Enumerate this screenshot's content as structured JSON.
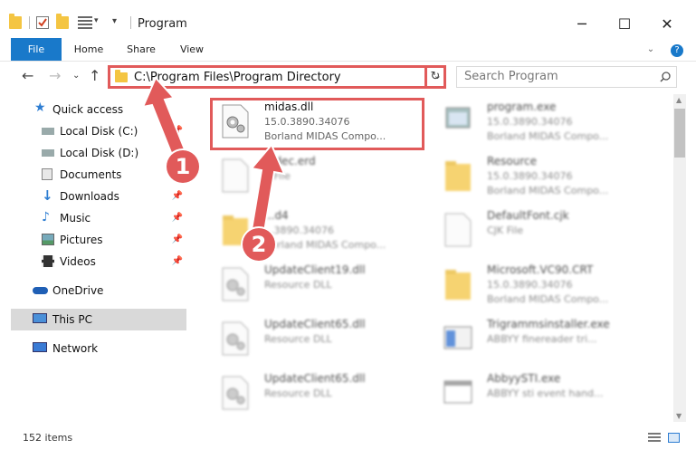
{
  "window": {
    "title": "Program",
    "minimize": "─",
    "maximize": "☐",
    "close": "✕"
  },
  "ribbon": {
    "tabs": [
      "File",
      "Home",
      "Share",
      "View"
    ],
    "help": "?"
  },
  "address": {
    "path": "C:\\Program Files\\Program Directory",
    "search_placeholder": "Search Program"
  },
  "navigation": {
    "items": [
      {
        "label": "Quick access",
        "icon": "star-icon"
      },
      {
        "label": "Local Disk (C:)",
        "icon": "drive-icon",
        "pinned": true
      },
      {
        "label": "Local Disk (D:)",
        "icon": "drive-icon"
      },
      {
        "label": "Documents",
        "icon": "documents-icon"
      },
      {
        "label": "Downloads",
        "icon": "downloads-icon",
        "pinned": true
      },
      {
        "label": "Music",
        "icon": "music-icon",
        "pinned": true
      },
      {
        "label": "Pictures",
        "icon": "pictures-icon",
        "pinned": true
      },
      {
        "label": "Videos",
        "icon": "videos-icon",
        "pinned": true
      },
      {
        "label": "OneDrive",
        "icon": "cloud-icon"
      },
      {
        "label": "This PC",
        "icon": "computer-icon",
        "selected": true
      },
      {
        "label": "Network",
        "icon": "network-icon"
      }
    ]
  },
  "files": [
    {
      "name": "midas.dll",
      "line2": "15.0.3890.34076",
      "line3": "Borland MIDAS Compo...",
      "type": "dll"
    },
    {
      "name": "program.exe",
      "line2": "15.0.3890.34076",
      "line3": "Borland MIDAS Compo...",
      "type": "exe"
    },
    {
      "name": "...dec.erd",
      "line2": "...File",
      "line3": "",
      "type": "file"
    },
    {
      "name": "Resource",
      "line2": "15.0.3890.34076",
      "line3": "Borland MIDAS Compo...",
      "type": "folder"
    },
    {
      "name": "...d4",
      "line2": "...3890.34076",
      "line3": "Borland MIDAS Compo...",
      "type": "folder"
    },
    {
      "name": "DefaultFont.cjk",
      "line2": "CJK File",
      "line3": "",
      "type": "file"
    },
    {
      "name": "UpdateClient19.dll",
      "line2": "Resource DLL",
      "line3": "",
      "type": "dll"
    },
    {
      "name": "Microsoft.VC90.CRT",
      "line2": "15.0.3890.34076",
      "line3": "Borland MIDAS Compo...",
      "type": "folder"
    },
    {
      "name": "UpdateClient65.dll",
      "line2": "Resource DLL",
      "line3": "",
      "type": "dll"
    },
    {
      "name": "Trigrammsinstaller.exe",
      "line2": "ABBYY finereader tri...",
      "line3": "",
      "type": "exe"
    },
    {
      "name": "UpdateClient65.dll",
      "line2": "Resource DLL",
      "line3": "",
      "type": "dll"
    },
    {
      "name": "AbbyySTI.exe",
      "line2": "ABBYY sti event hand...",
      "line3": "",
      "type": "exe"
    }
  ],
  "status": {
    "count": "152 items"
  },
  "annotations": {
    "step1": "1",
    "step2": "2"
  },
  "colors": {
    "accent": "#1979ca",
    "highlight": "#e15a5a"
  }
}
